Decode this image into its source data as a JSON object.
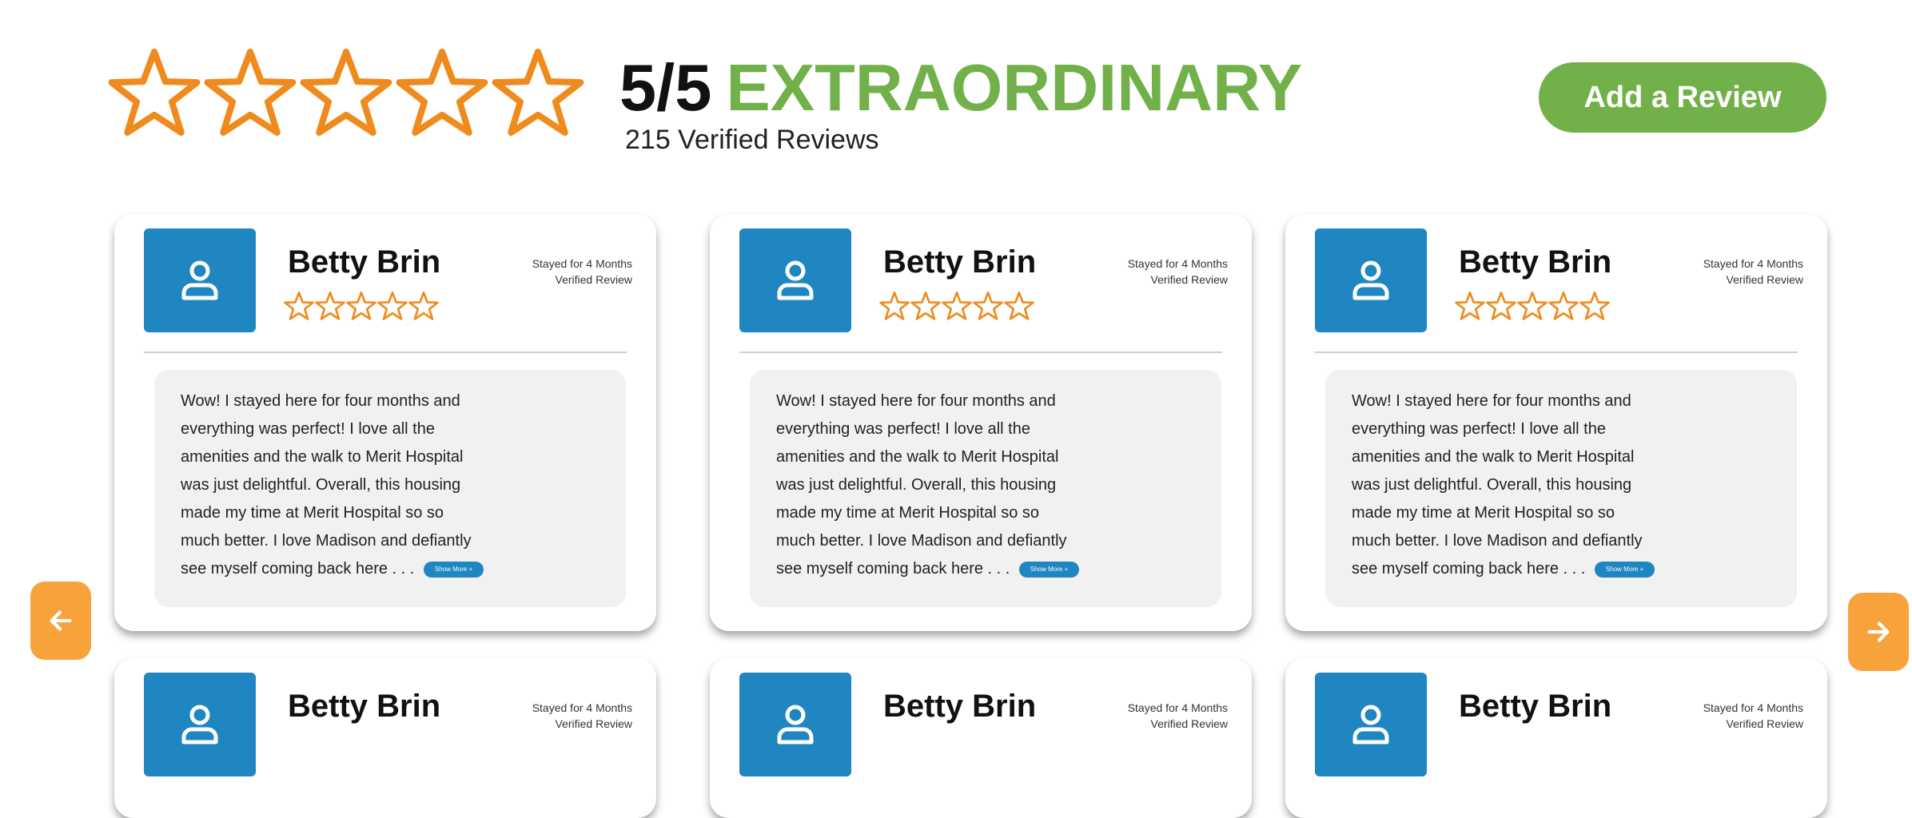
{
  "summary": {
    "score": "5/5",
    "label": "EXTRAORDINARY",
    "count_text": "215 Verified Reviews",
    "stars": 5,
    "add_button": "Add a Review"
  },
  "icons": {
    "star": "star-outline-icon",
    "avatar": "user-icon",
    "prev": "arrow-left-icon",
    "next": "arrow-right-icon"
  },
  "colors": {
    "accent_green": "#72b14a",
    "star_orange": "#f08a1c",
    "avatar_blue": "#1f86c1",
    "arrow_orange": "#f7a23b",
    "bubble_gray": "#f1f1f1"
  },
  "reviews": [
    {
      "name": "Betty Brin",
      "stay": "Stayed for 4 Months",
      "verified": "Verified Review",
      "text": "Wow! I stayed here for four months and everything was perfect! I love all the amenities and the walk to Merit Hospital was just delightful. Overall, this housing made my time at Merit Hospital so so much better. I love Madison and defiantly see myself coming back here . . .",
      "show_more": "Show More +"
    },
    {
      "name": "Betty Brin",
      "stay": "Stayed for 4 Months",
      "verified": "Verified Review",
      "text": "Wow! I stayed here for four months and everything was perfect! I love all the amenities and the walk to Merit Hospital was just delightful. Overall, this housing made my time at Merit Hospital so so much better. I love Madison and defiantly see myself coming back here . . .",
      "show_more": "Show More +"
    },
    {
      "name": "Betty Brin",
      "stay": "Stayed for 4 Months",
      "verified": "Verified Review",
      "text": "Wow! I stayed here for four months and everything was perfect! I love all the amenities and the walk to Merit Hospital was just delightful. Overall, this housing made my time at Merit Hospital so so much better. I love Madison and defiantly see myself coming back here . . .",
      "show_more": "Show More +"
    },
    {
      "name": "Betty Brin",
      "stay": "Stayed for 4 Months",
      "verified": "Verified Review"
    },
    {
      "name": "Betty Brin",
      "stay": "Stayed for 4 Months",
      "verified": "Verified Review"
    },
    {
      "name": "Betty Brin",
      "stay": "Stayed for 4 Months",
      "verified": "Verified Review"
    }
  ]
}
